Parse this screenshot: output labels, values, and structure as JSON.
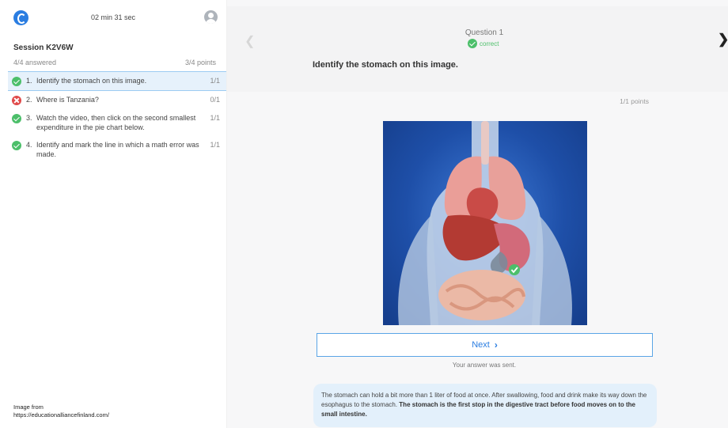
{
  "header": {
    "timer": "02 min 31 sec"
  },
  "sidebar": {
    "session_title": "Session K2V6W",
    "answered": "4/4 answered",
    "points": "3/4 points",
    "questions": [
      {
        "number": "1.",
        "text": "Identify the stomach on this image.",
        "score": "1/1",
        "status": "correct"
      },
      {
        "number": "2.",
        "text": "Where is Tanzania?",
        "score": "0/1",
        "status": "wrong"
      },
      {
        "number": "3.",
        "text": "Watch the video, then click on the second smallest expenditure in the pie chart below.",
        "score": "1/1",
        "status": "correct"
      },
      {
        "number": "4.",
        "text": "Identify and mark the line in which a math error was made.",
        "score": "1/1",
        "status": "correct"
      }
    ],
    "credit_line1": "Image from",
    "credit_line2": "https://educationalliancefinland.com/"
  },
  "main": {
    "question_label": "Question 1",
    "status_text": "correct",
    "question_text": "Identify the stomach on this image.",
    "points_text": "1/1 points",
    "next_label": "Next",
    "sent_text": "Your answer was sent.",
    "info_text": "The stomach can hold a bit more than 1 liter of food at once. After swallowing, food and drink make its way down the esophagus to the stomach.",
    "info_bold": "The stomach is the first stop in the digestive tract before food moves on to the small intestine."
  },
  "colors": {
    "accent": "#2a7de1",
    "correct": "#4cbf6a",
    "wrong": "#e04a4a",
    "info_bg": "#e3f0fb"
  },
  "icons": [
    "app-logo-icon",
    "profile-icon",
    "check-circle-icon",
    "x-circle-icon",
    "chevron-left-icon",
    "chevron-right-icon"
  ]
}
